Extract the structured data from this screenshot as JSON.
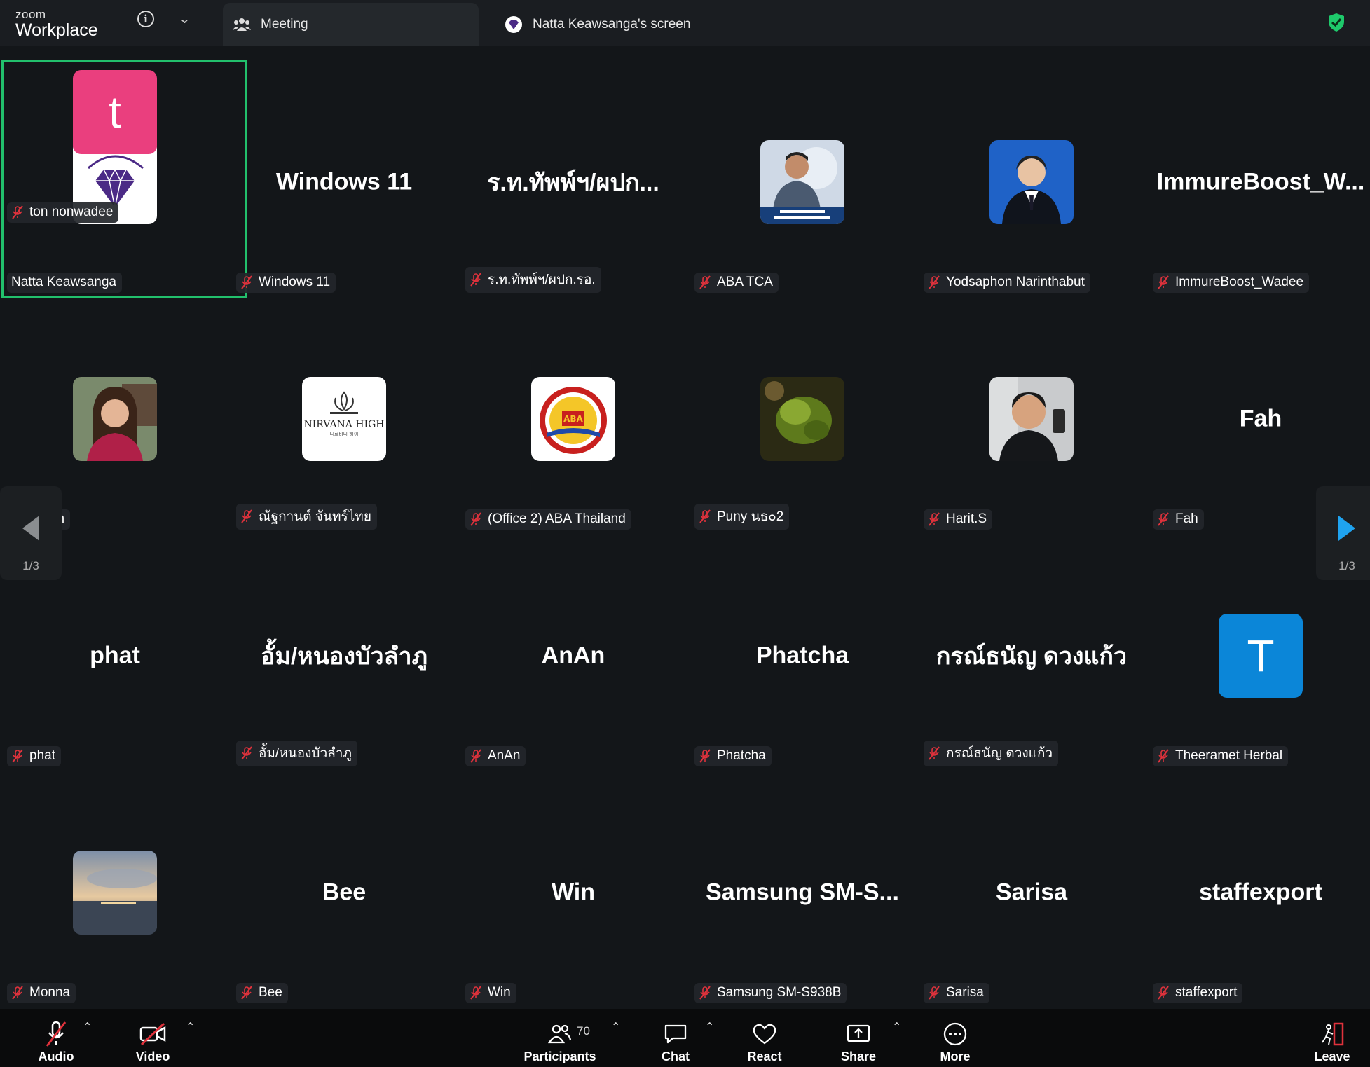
{
  "app": {
    "brand_small": "zoom",
    "brand_main": "Workplace",
    "tab_meeting": "Meeting",
    "tab_screen": "Natta Keawsanga's screen"
  },
  "tiles": [
    {
      "big": "",
      "label": "Natta Keawsanga",
      "muted": false,
      "avatar": "natta-logo"
    },
    {
      "big": "Windows 11",
      "label": "Windows 11",
      "muted": true
    },
    {
      "big": "ร.ท.ทัพพ์ฯ/ผปก...",
      "label": "ร.ท.ทัพพ์ฯ/ผปก.รอ.",
      "muted": true
    },
    {
      "big": "",
      "label": "ABA TCA",
      "muted": true,
      "avatar": "man-suit-photo"
    },
    {
      "big": "",
      "label": "Yodsaphon Narinthabut",
      "muted": true,
      "avatar": "young-man-photo"
    },
    {
      "big": "ImmureBoost_W...",
      "label": "ImmureBoost_Wadee",
      "muted": true
    },
    {
      "big": "",
      "label": "Jaichuen",
      "muted": false,
      "avatar": "woman-photo"
    },
    {
      "big": "",
      "label": "ณัฐกานต์ จันทร์ไทย",
      "muted": true,
      "avatar": "nirvana-logo"
    },
    {
      "big": "",
      "label": "(Office 2) ABA Thailand",
      "muted": true,
      "avatar": "aba-logo"
    },
    {
      "big": "",
      "label": "Puny นธ๐2",
      "muted": true,
      "avatar": "plant-photo"
    },
    {
      "big": "",
      "label": "Harit.S",
      "muted": true,
      "avatar": "man-selfie-photo"
    },
    {
      "big": "Fah",
      "label": "Fah",
      "muted": true
    },
    {
      "big": "phat",
      "label": "phat",
      "muted": true
    },
    {
      "big": "อั้ม/หนองบัวลำภู",
      "label": "อั้ม/หนองบัวลำภู",
      "muted": true
    },
    {
      "big": "AnAn",
      "label": "AnAn",
      "muted": true
    },
    {
      "big": "Phatcha",
      "label": "Phatcha",
      "muted": true
    },
    {
      "big": "กรณ์ธนัญ ดวงแก้ว",
      "label": "กรณ์ธนัญ ดวงแก้ว",
      "muted": true
    },
    {
      "big": "",
      "label": "Theeramet Herbal",
      "muted": true,
      "letter": "T",
      "letter_color": "#0b86d8"
    },
    {
      "big": "",
      "label": "Monna",
      "muted": true,
      "avatar": "sunset-photo"
    },
    {
      "big": "Bee",
      "label": "Bee",
      "muted": true
    },
    {
      "big": "Win",
      "label": "Win",
      "muted": true
    },
    {
      "big": "Samsung  SM-S...",
      "label": "Samsung SM-S938B",
      "muted": true
    },
    {
      "big": "Sarisa",
      "label": "Sarisa",
      "muted": true
    },
    {
      "big": "staffexport",
      "label": "staffexport",
      "muted": true
    },
    {
      "big": "",
      "label": "ton nonwadee",
      "muted": true,
      "letter": "t",
      "letter_color": "#ea3f7e"
    }
  ],
  "pager": {
    "left": "1/3",
    "right": "1/3"
  },
  "toolbar": {
    "audio": "Audio",
    "video": "Video",
    "participants": "Participants",
    "participant_count": "70",
    "chat": "Chat",
    "react": "React",
    "share": "Share",
    "more": "More",
    "leave": "Leave"
  },
  "colors": {
    "active_speaker": "#22c06c",
    "accent_blue": "#1fa3f0",
    "muted_red": "#e0323c",
    "shield_green": "#1ec96b"
  }
}
